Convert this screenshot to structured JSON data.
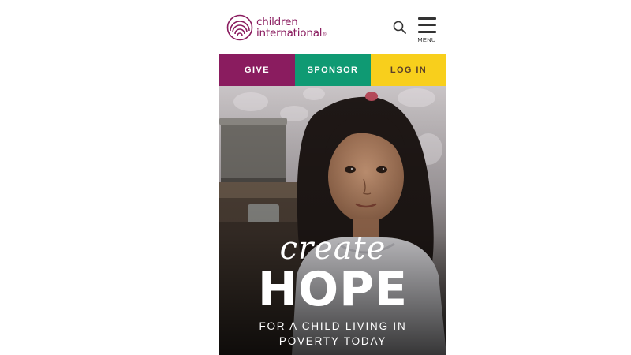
{
  "brand": {
    "name_line1": "children",
    "name_line2": "international",
    "registered_mark": "®",
    "logo_icon": "concentric-arcs-logo",
    "color": "#8a1c5f"
  },
  "header": {
    "search_icon": "search-icon",
    "menu_icon": "hamburger-icon",
    "menu_label": "MENU"
  },
  "cta_bar": {
    "give_label": "GIVE",
    "sponsor_label": "SPONSOR",
    "login_label": "LOG IN",
    "colors": {
      "give": "#8a1c5f",
      "sponsor": "#0f9a73",
      "login": "#f8cf1c"
    }
  },
  "hero": {
    "line1": "create",
    "line2": "HOPE",
    "tagline_line1": "FOR A CHILD LIVING IN",
    "tagline_line2": "POVERTY TODAY"
  }
}
